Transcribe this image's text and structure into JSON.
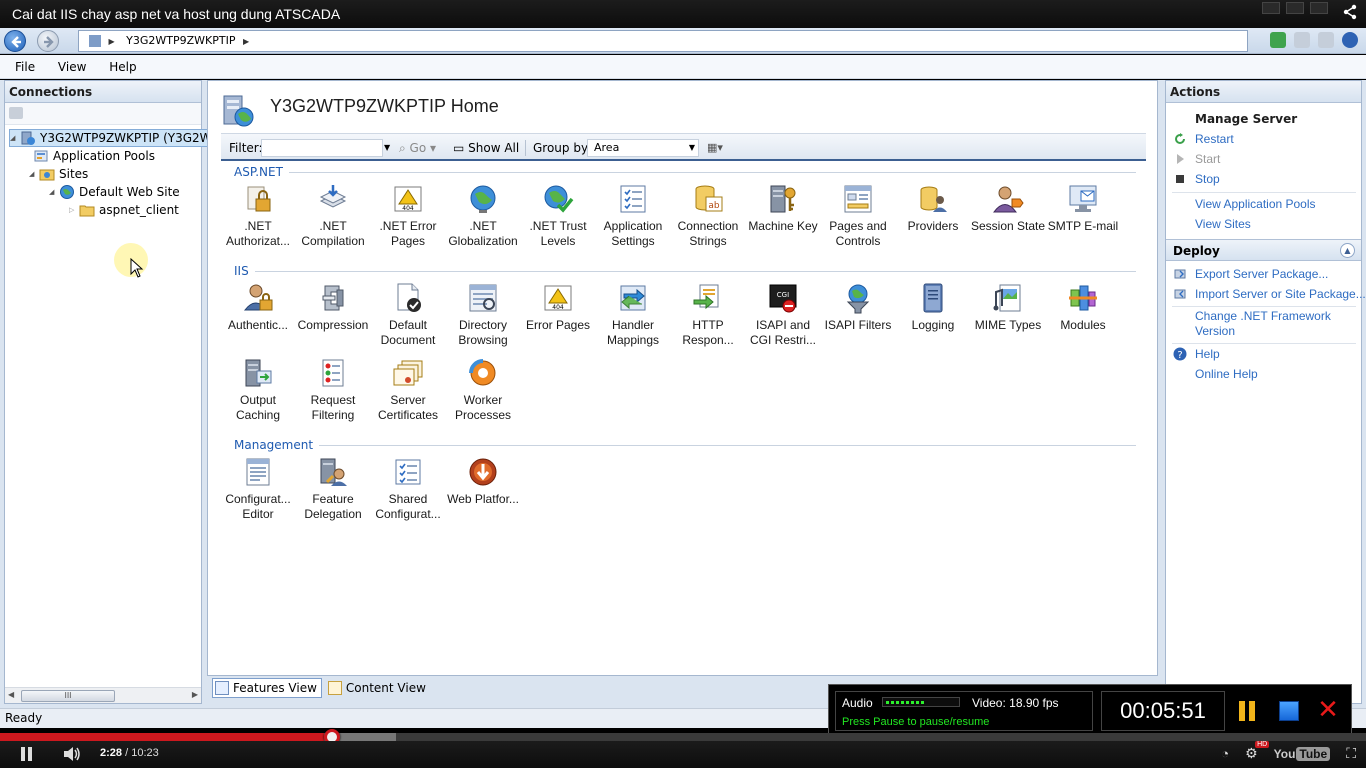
{
  "video_title": "Cai dat IIS chay asp net va host ung dung ATSCADA",
  "address": {
    "crumb": "Y3G2WTP9ZWKPTIP"
  },
  "menu": [
    "File",
    "View",
    "Help"
  ],
  "connections": {
    "title": "Connections",
    "tree": [
      {
        "label": "Y3G2WTP9ZWKPTIP (Y3G2WT",
        "icon": "server-icon"
      },
      {
        "label": "Application Pools",
        "icon": "app-pools-icon"
      },
      {
        "label": "Sites",
        "icon": "sites-folder-icon"
      },
      {
        "label": "Default Web Site",
        "icon": "globe-icon"
      },
      {
        "label": "aspnet_client",
        "icon": "folder-icon"
      }
    ],
    "scroll_thumb_glyph": "III"
  },
  "home": {
    "title": "Y3G2WTP9ZWKPTIP Home"
  },
  "filter_bar": {
    "filter_label": "Filter:",
    "go_label": "Go",
    "show_all_label": "Show All",
    "group_by_label": "Group by:",
    "group_by_value": "Area"
  },
  "groups": [
    {
      "name": "ASP.NET",
      "items": [
        {
          "label": ".NET Authorizat...",
          "icon": "lock-user-icon"
        },
        {
          "label": ".NET Compilation",
          "icon": "stack-arrow-icon"
        },
        {
          "label": ".NET Error Pages",
          "icon": "warning-404-icon"
        },
        {
          "label": ".NET Globalization",
          "icon": "globe-icon"
        },
        {
          "label": ".NET Trust Levels",
          "icon": "globe-check-icon"
        },
        {
          "label": "Application Settings",
          "icon": "checklist-icon"
        },
        {
          "label": "Connection Strings",
          "icon": "database-ab-icon"
        },
        {
          "label": "Machine Key",
          "icon": "key-server-icon"
        },
        {
          "label": "Pages and Controls",
          "icon": "page-controls-icon"
        },
        {
          "label": "Providers",
          "icon": "providers-icon"
        },
        {
          "label": "Session State",
          "icon": "user-arrow-icon"
        },
        {
          "label": "SMTP E-mail",
          "icon": "email-monitor-icon"
        }
      ]
    },
    {
      "name": "IIS",
      "items": [
        {
          "label": "Authentic...",
          "icon": "user-lock-icon"
        },
        {
          "label": "Compression",
          "icon": "clamp-icon"
        },
        {
          "label": "Default Document",
          "icon": "document-check-icon"
        },
        {
          "label": "Directory Browsing",
          "icon": "directory-icon"
        },
        {
          "label": "Error Pages",
          "icon": "warning-404-icon"
        },
        {
          "label": "Handler Mappings",
          "icon": "handler-arrows-icon"
        },
        {
          "label": "HTTP Respon...",
          "icon": "http-arrows-icon"
        },
        {
          "label": "ISAPI and CGI Restri...",
          "icon": "cgi-block-icon"
        },
        {
          "label": "ISAPI Filters",
          "icon": "filter-globe-icon"
        },
        {
          "label": "Logging",
          "icon": "log-book-icon"
        },
        {
          "label": "MIME Types",
          "icon": "mime-media-icon"
        },
        {
          "label": "Modules",
          "icon": "modules-icon"
        },
        {
          "label": "Output Caching",
          "icon": "output-cache-icon"
        },
        {
          "label": "Request Filtering",
          "icon": "request-filter-icon"
        },
        {
          "label": "Server Certificates",
          "icon": "certificates-icon"
        },
        {
          "label": "Worker Processes",
          "icon": "worker-gear-icon"
        }
      ]
    },
    {
      "name": "Management",
      "items": [
        {
          "label": "Configurat... Editor",
          "icon": "config-editor-icon"
        },
        {
          "label": "Feature Delegation",
          "icon": "feature-delegation-icon"
        },
        {
          "label": "Shared Configurat...",
          "icon": "shared-config-icon"
        },
        {
          "label": "Web Platfor...",
          "icon": "web-platform-icon"
        }
      ]
    }
  ],
  "view_tabs": [
    {
      "label": "Features View",
      "active": true
    },
    {
      "label": "Content View",
      "active": false
    }
  ],
  "actions": {
    "title": "Actions",
    "manage_server": {
      "title": "Manage Server",
      "items": [
        {
          "label": "Restart",
          "icon": "restart-icon",
          "enabled": true
        },
        {
          "label": "Start",
          "icon": "start-icon",
          "enabled": false
        },
        {
          "label": "Stop",
          "icon": "stop-icon",
          "enabled": true
        },
        {
          "label": "View Application Pools",
          "icon": "",
          "enabled": true
        },
        {
          "label": "View Sites",
          "icon": "",
          "enabled": true
        }
      ]
    },
    "deploy": {
      "title": "Deploy",
      "items": [
        {
          "label": "Export Server Package...",
          "icon": "export-icon"
        },
        {
          "label": "Import Server or Site Package...",
          "icon": "import-icon"
        },
        {
          "label": "Change .NET Framework Version",
          "icon": ""
        }
      ]
    },
    "help": [
      {
        "label": "Help",
        "icon": "help-icon"
      },
      {
        "label": "Online Help",
        "icon": ""
      }
    ]
  },
  "status_text": "Ready",
  "recorder": {
    "audio_label": "Audio",
    "video_label": "Video: 18.90 fps",
    "hint": "Press Pause to pause/resume",
    "timer": "00:05:51"
  },
  "player": {
    "current_time": "2:28",
    "duration": "10:23",
    "progress_fraction": 0.2375,
    "buffered_fraction": 0.29,
    "hd_badge": "HD",
    "logo_you": "You",
    "logo_tube": "Tube"
  },
  "colors": {
    "link": "#2e6cc2",
    "group_head": "#1e5ab0",
    "progress": "#cc181e"
  }
}
